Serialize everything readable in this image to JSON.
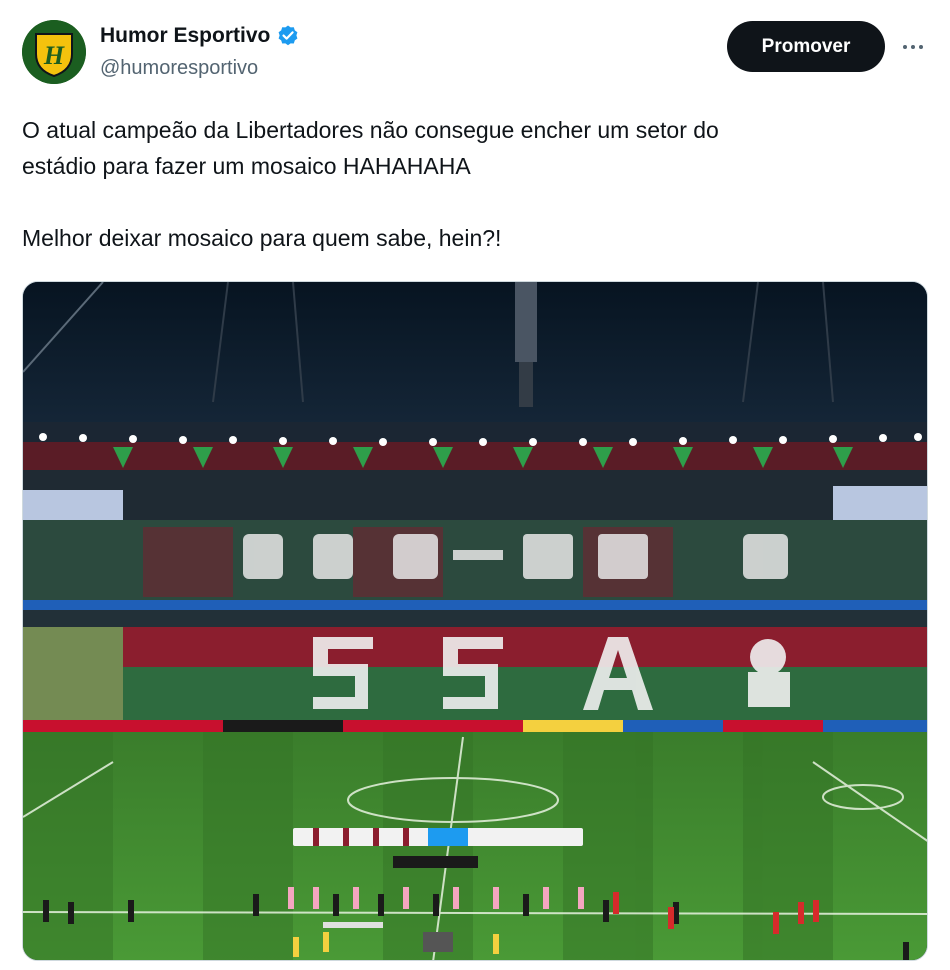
{
  "author": {
    "display_name": "Humor Esportivo",
    "handle": "@humoresportivo",
    "verified": true,
    "avatar_icon": "shield-logo-icon",
    "avatar_letter": "H"
  },
  "actions": {
    "promote_label": "Promover",
    "more_icon": "ellipsis-icon"
  },
  "tweet": {
    "line1": "O atual campeão da Libertadores não consegue encher um setor do",
    "line2": "estádio para fazer um mosaico HAHAHAHA",
    "line3": "Melhor deixar mosaico para quem sabe, hein?!"
  },
  "media": {
    "type": "photo",
    "colors": {
      "sky": "#0b1a2a",
      "grass": "#3f8a2e",
      "maroon": "#8b1e2e",
      "green": "#2e6b3f",
      "accent": "#1d9bf0"
    }
  }
}
